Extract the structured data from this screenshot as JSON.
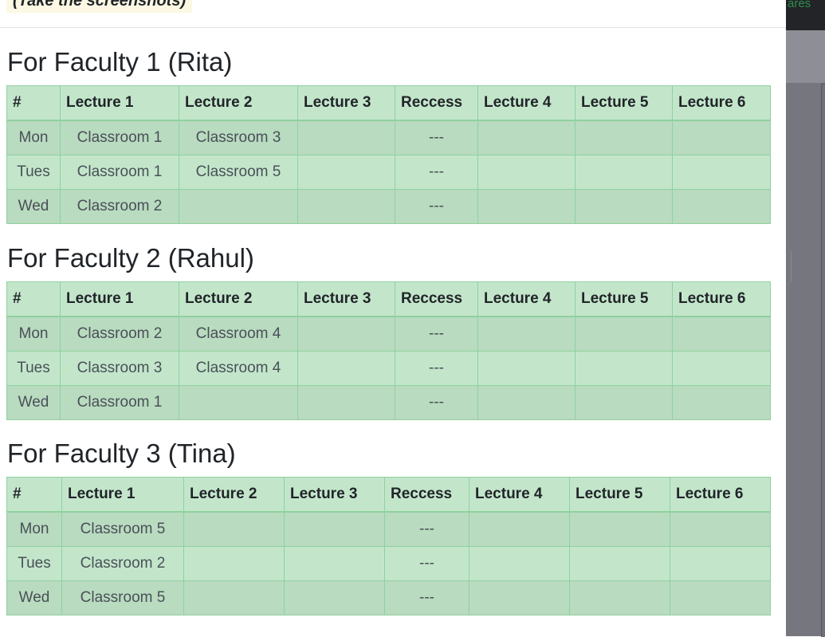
{
  "backdrop": {
    "peek_text": "ares"
  },
  "note": "(Take the screenshots)",
  "columns": [
    "#",
    "Lecture 1",
    "Lecture 2",
    "Lecture 3",
    "Reccess",
    "Lecture 4",
    "Lecture 5",
    "Lecture 6"
  ],
  "faculties": [
    {
      "title": "For Faculty 1 (Rita)",
      "rows": [
        [
          "Mon",
          "Classroom 1",
          "Classroom 3",
          "",
          "---",
          "",
          "",
          ""
        ],
        [
          "Tues",
          "Classroom 1",
          "Classroom 5",
          "",
          "---",
          "",
          "",
          ""
        ],
        [
          "Wed",
          "Classroom 2",
          "",
          "",
          "---",
          "",
          "",
          ""
        ]
      ]
    },
    {
      "title": "For Faculty 2 (Rahul)",
      "rows": [
        [
          "Mon",
          "Classroom 2",
          "Classroom 4",
          "",
          "---",
          "",
          "",
          ""
        ],
        [
          "Tues",
          "Classroom 3",
          "Classroom 4",
          "",
          "---",
          "",
          "",
          ""
        ],
        [
          "Wed",
          "Classroom 1",
          "",
          "",
          "---",
          "",
          "",
          ""
        ]
      ]
    },
    {
      "title": "For Faculty 3 (Tina)",
      "rows": [
        [
          "Mon",
          "Classroom 5",
          "",
          "",
          "---",
          "",
          "",
          ""
        ],
        [
          "Tues",
          "Classroom 2",
          "",
          "",
          "---",
          "",
          "",
          ""
        ],
        [
          "Wed",
          "Classroom 5",
          "",
          "",
          "---",
          "",
          "",
          ""
        ]
      ]
    }
  ]
}
